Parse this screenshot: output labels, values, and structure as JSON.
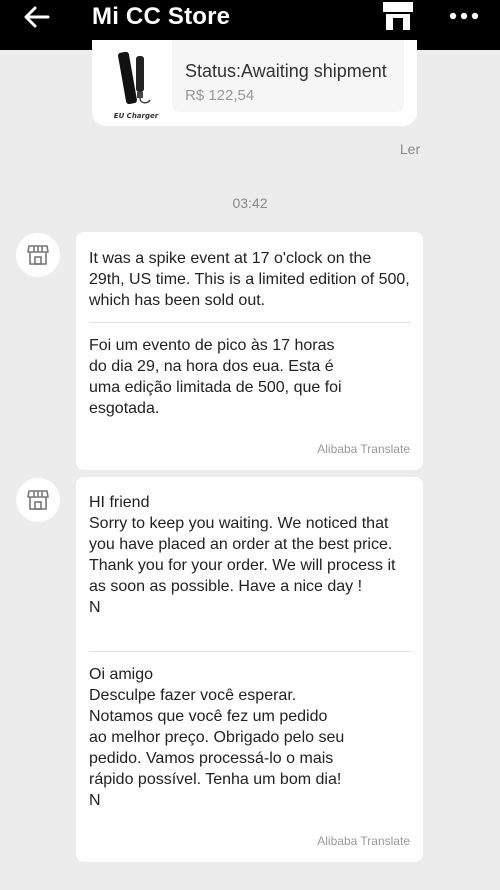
{
  "header": {
    "title": "Mi CC Store",
    "back_icon": "arrow-left-icon",
    "store_icon": "store-icon",
    "more_icon": "more-dots-icon"
  },
  "order": {
    "thumb_label": "EU Charger",
    "status": "Status:Awaiting shipment",
    "price": "R$ 122,54"
  },
  "read_receipt": "Ler",
  "timestamp": "03:42",
  "messages": [
    {
      "original": "It was a spike event at 17 o'clock on the 29th, US time. This is a limited edition of 500, which has been sold out.",
      "translated": "Foi um evento de pico às 17 horas\ndo dia 29, na hora dos eua. Esta é\numa edição limitada de 500, que foi\nesgotada.",
      "translator": "Alibaba Translate"
    },
    {
      "original": "HI friend\nSorry to keep you waiting. We noticed that you have placed an order at the best price. Thank you for your order. We will process it as soon as possible. Have a nice day !\nN",
      "translated": "Oi amigo\nDesculpe fazer você esperar.\nNotamos que você fez um pedido\nao melhor preço. Obrigado pelo seu\npedido. Vamos processá-lo o mais\nrápido possível. Tenha um bom dia!\nN",
      "translator": "Alibaba Translate"
    }
  ]
}
